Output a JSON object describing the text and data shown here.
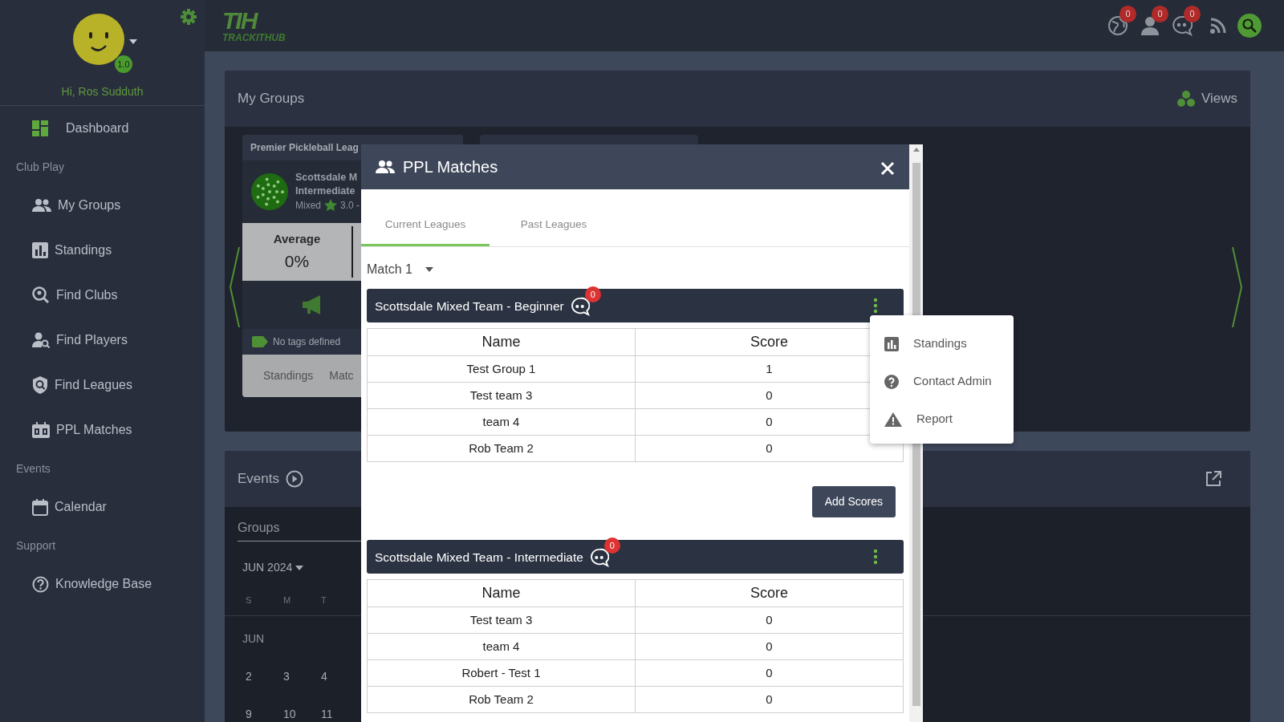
{
  "sidebar": {
    "greeting": "Hi, Ros Sudduth",
    "rating": "1.0",
    "items": [
      {
        "kind": "link",
        "label": "Dashboard"
      },
      {
        "kind": "section",
        "label": "Club Play"
      },
      {
        "kind": "link",
        "label": "My Groups"
      },
      {
        "kind": "link",
        "label": "Standings"
      },
      {
        "kind": "link",
        "label": "Find Clubs"
      },
      {
        "kind": "link",
        "label": "Find Players"
      },
      {
        "kind": "link",
        "label": "Find Leagues"
      },
      {
        "kind": "link",
        "label": "PPL Matches"
      },
      {
        "kind": "section",
        "label": "Events"
      },
      {
        "kind": "link",
        "label": "Calendar"
      },
      {
        "kind": "section",
        "label": "Support"
      },
      {
        "kind": "link",
        "label": "Knowledge Base"
      }
    ]
  },
  "topbar": {
    "logo_mark": "TIH",
    "logo_wordmark": "TRACKITHUB",
    "notifications": [
      {
        "count": "0"
      },
      {
        "count": "0"
      },
      {
        "count": "0"
      }
    ]
  },
  "my_groups": {
    "title": "My Groups",
    "views_label": "Views",
    "card": {
      "league": "Premier Pickleball Leag",
      "team_line_1": "Scottsdale M",
      "team_line_2": "Intermediate",
      "format": "Mixed",
      "rating": "3.0 -",
      "stat_label": "Average",
      "stat_value": "0%",
      "tags": "No tags defined",
      "tabs": [
        "Standings",
        "Matc"
      ]
    }
  },
  "events": {
    "title": "Events",
    "filter_label": "Groups",
    "month": "JUN 2024",
    "weekdays": [
      "S",
      "M",
      "T"
    ],
    "month_label": "JUN",
    "weeks": [
      [
        "2",
        "3",
        "4"
      ],
      [
        "9",
        "10",
        "11"
      ]
    ]
  },
  "modal": {
    "title": "PPL Matches",
    "tabs": [
      {
        "label": "Current Leagues",
        "selected": true
      },
      {
        "label": "Past Leagues",
        "selected": false
      }
    ],
    "match_select": "Match 1",
    "groups": [
      {
        "name": "Scottsdale Mixed Team - Beginner",
        "messages": "0",
        "columns": [
          "Name",
          "Score"
        ],
        "rows": [
          [
            "Test Group 1",
            "1"
          ],
          [
            "Test team 3",
            "0"
          ],
          [
            "team 4",
            "0"
          ],
          [
            "Rob Team 2",
            "0"
          ]
        ],
        "button": "Add Scores"
      },
      {
        "name": "Scottsdale Mixed Team - Intermediate",
        "messages": "0",
        "columns": [
          "Name",
          "Score"
        ],
        "rows": [
          [
            "Test team 3",
            "0"
          ],
          [
            "team 4",
            "0"
          ],
          [
            "Robert - Test 1",
            "0"
          ],
          [
            "Rob Team 2",
            "0"
          ]
        ]
      }
    ]
  },
  "menu": {
    "items": [
      "Standings",
      "Contact Admin",
      "Report"
    ]
  }
}
